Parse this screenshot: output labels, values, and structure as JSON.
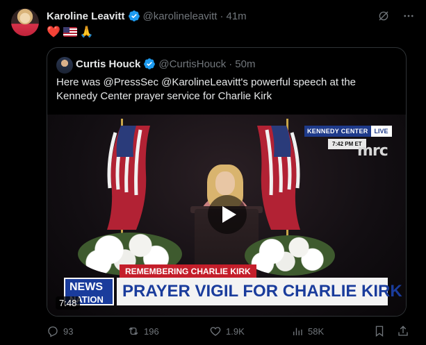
{
  "tweet": {
    "author_name": "Karoline Leavitt",
    "author_handle": "@karolineleavitt",
    "separator": "·",
    "time": "41m",
    "emoji_heart": "❤️",
    "emoji_hands": "🙏"
  },
  "quoted": {
    "author_name": "Curtis Houck",
    "author_handle": "@CurtisHouck",
    "separator": "·",
    "time": "50m",
    "text": "Here was @PressSec @KarolineLeavitt's powerful speech at the Kennedy Center prayer service for Charlie Kirk",
    "video": {
      "bug_venue": "KENNEDY CENTER",
      "bug_live": "LIVE",
      "bug_time": "7:42 PM ET",
      "network_logo": "mrc",
      "banner_top": "REMEMBERING CHARLIE KIRK",
      "banner_main": "PRAYER VIGIL FOR CHARLIE KIRK",
      "channel_line1": "NEWS",
      "channel_line2": "NATION",
      "duration": "7:48"
    }
  },
  "actions": {
    "replies": "93",
    "reposts": "196",
    "likes": "1.9K",
    "views": "58K"
  },
  "colors": {
    "background": "#000000",
    "text_primary": "#e7e9ea",
    "text_secondary": "#71767b",
    "verified": "#1d9bf0",
    "border": "#2f3336"
  }
}
